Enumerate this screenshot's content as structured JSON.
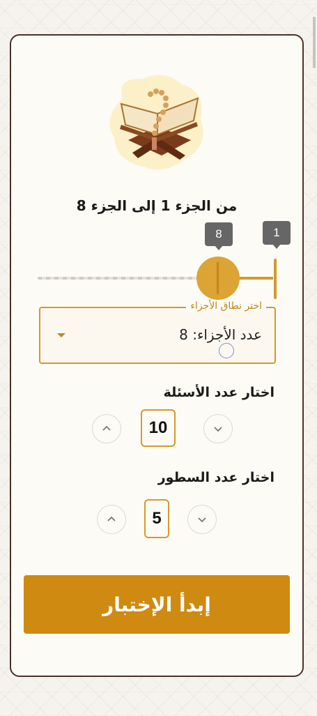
{
  "range": {
    "title": "من الجزء 1 إلى الجزء 8",
    "start_tooltip": "8",
    "end_tooltip": "1"
  },
  "select": {
    "legend": "اختر نطاق الأجزاء",
    "value": "عدد الأجزاء: 8"
  },
  "questions": {
    "label": "اختار عدد الأسئلة",
    "value": "10"
  },
  "lines": {
    "label": "اختار عدد السطور",
    "value": "5"
  },
  "start_button": {
    "label": "إبدأ الإختبار"
  },
  "icons": {
    "increment": "chevron-up-icon",
    "decrement": "chevron-down-icon",
    "dropdown": "caret-down-icon"
  },
  "colors": {
    "accent": "#d39a2a",
    "button": "#cf8a12",
    "card_border": "#4a3226"
  }
}
